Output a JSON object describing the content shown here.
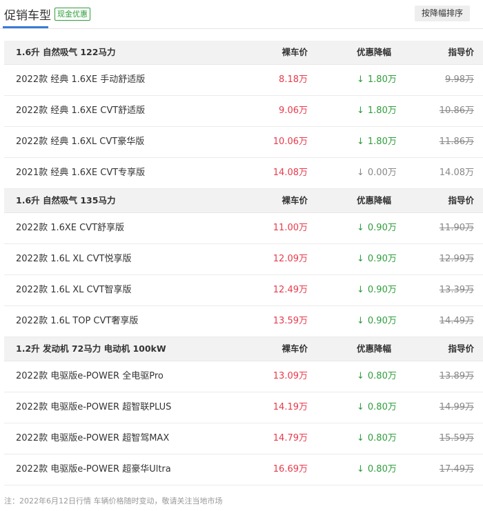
{
  "header": {
    "title": "促销车型",
    "tag": "现金优惠",
    "sort_button": "按降幅排序"
  },
  "groups": [
    {
      "name": "1.6升 自然吸气 122马力",
      "col_price": "裸车价",
      "col_discount": "优惠降幅",
      "col_guide": "指导价",
      "rows": [
        {
          "name": "2022款 经典 1.6XE 手动舒适版",
          "price": "8.18万",
          "discount": "1.80万",
          "guide": "9.98万",
          "strike": true
        },
        {
          "name": "2022款 经典 1.6XE CVT舒适版",
          "price": "9.06万",
          "discount": "1.80万",
          "guide": "10.86万",
          "strike": true
        },
        {
          "name": "2022款 经典 1.6XL CVT豪华版",
          "price": "10.06万",
          "discount": "1.80万",
          "guide": "11.86万",
          "strike": true
        },
        {
          "name": "2021款 经典 1.6XE CVT专享版",
          "price": "14.08万",
          "discount": "0.00万",
          "guide": "14.08万",
          "strike": false
        }
      ]
    },
    {
      "name": "1.6升 自然吸气 135马力",
      "col_price": "裸车价",
      "col_discount": "优惠降幅",
      "col_guide": "指导价",
      "rows": [
        {
          "name": "2022款 1.6XE CVT舒享版",
          "price": "11.00万",
          "discount": "0.90万",
          "guide": "11.90万",
          "strike": true
        },
        {
          "name": "2022款 1.6L XL CVT悦享版",
          "price": "12.09万",
          "discount": "0.90万",
          "guide": "12.99万",
          "strike": true
        },
        {
          "name": "2022款 1.6L XL CVT智享版",
          "price": "12.49万",
          "discount": "0.90万",
          "guide": "13.39万",
          "strike": true
        },
        {
          "name": "2022款 1.6L TOP CVT奢享版",
          "price": "13.59万",
          "discount": "0.90万",
          "guide": "14.49万",
          "strike": true
        }
      ]
    },
    {
      "name": "1.2升 发动机 72马力 电动机 100kW",
      "col_price": "裸车价",
      "col_discount": "优惠降幅",
      "col_guide": "指导价",
      "rows": [
        {
          "name": "2022款 电驱版e-POWER 全电驱Pro",
          "price": "13.09万",
          "discount": "0.80万",
          "guide": "13.89万",
          "strike": true
        },
        {
          "name": "2022款 电驱版e-POWER 超智联PLUS",
          "price": "14.19万",
          "discount": "0.80万",
          "guide": "14.99万",
          "strike": true
        },
        {
          "name": "2022款 电驱版e-POWER 超智驾MAX",
          "price": "14.79万",
          "discount": "0.80万",
          "guide": "15.59万",
          "strike": true
        },
        {
          "name": "2022款 电驱版e-POWER 超豪华Ultra",
          "price": "16.69万",
          "discount": "0.80万",
          "guide": "17.49万",
          "strike": true
        }
      ]
    }
  ],
  "arrow_icon": "↓",
  "note": "注：2022年6月12日行情 车辆价格随时变动，敬请关注当地市场",
  "colors": {
    "price": "#e8394a",
    "discount": "#2e9d3a",
    "accent": "#3a7bd5"
  }
}
